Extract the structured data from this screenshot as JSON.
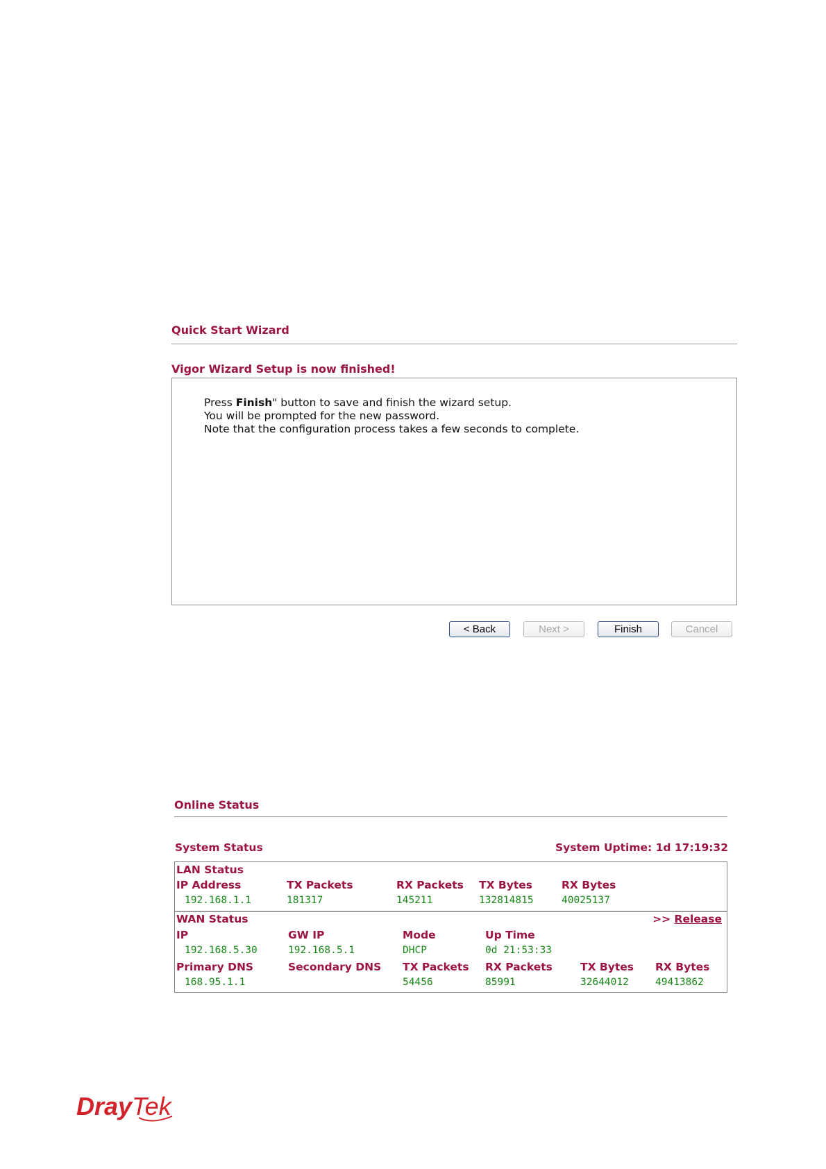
{
  "wizard": {
    "title": "Quick Start Wizard",
    "heading": "Vigor Wizard Setup is now finished!",
    "line1_pre": "Press ",
    "line1_bold": "Finish",
    "line1_post": "\" button to save and finish the wizard setup.",
    "line2": "You will be prompted for the new password.",
    "line3": "Note that the configuration process takes a few seconds to complete.",
    "buttons": {
      "back": "< Back",
      "next": "Next >",
      "finish": "Finish",
      "cancel": "Cancel"
    }
  },
  "online_status": {
    "title": "Online Status",
    "system_status_label": "System Status",
    "system_uptime": "System Uptime: 1d 17:19:32",
    "lan": {
      "label": "LAN Status",
      "headers": [
        "IP Address",
        "TX Packets",
        "RX Packets",
        "TX Bytes",
        "RX Bytes"
      ],
      "values": [
        "192.168.1.1",
        "181317",
        "145211",
        "132814815",
        "40025137"
      ]
    },
    "wan": {
      "label": "WAN Status",
      "release_prefix": ">> ",
      "release": "Release",
      "headers1": [
        "IP",
        "GW IP",
        "Mode",
        "Up Time"
      ],
      "values1": [
        "192.168.5.30",
        "192.168.5.1",
        "DHCP",
        "0d 21:53:33"
      ],
      "headers2": [
        "Primary DNS",
        "Secondary DNS",
        "TX Packets",
        "RX Packets",
        "TX Bytes",
        "RX Bytes"
      ],
      "values2": [
        "168.95.1.1",
        "",
        "54456",
        "85991",
        "32644012",
        "49413862"
      ]
    }
  },
  "logo": {
    "text_dray": "Dray",
    "text_tek": "Tek",
    "color": "#d2232a"
  },
  "colors": {
    "heading": "#9b1540",
    "value": "#188a18"
  }
}
